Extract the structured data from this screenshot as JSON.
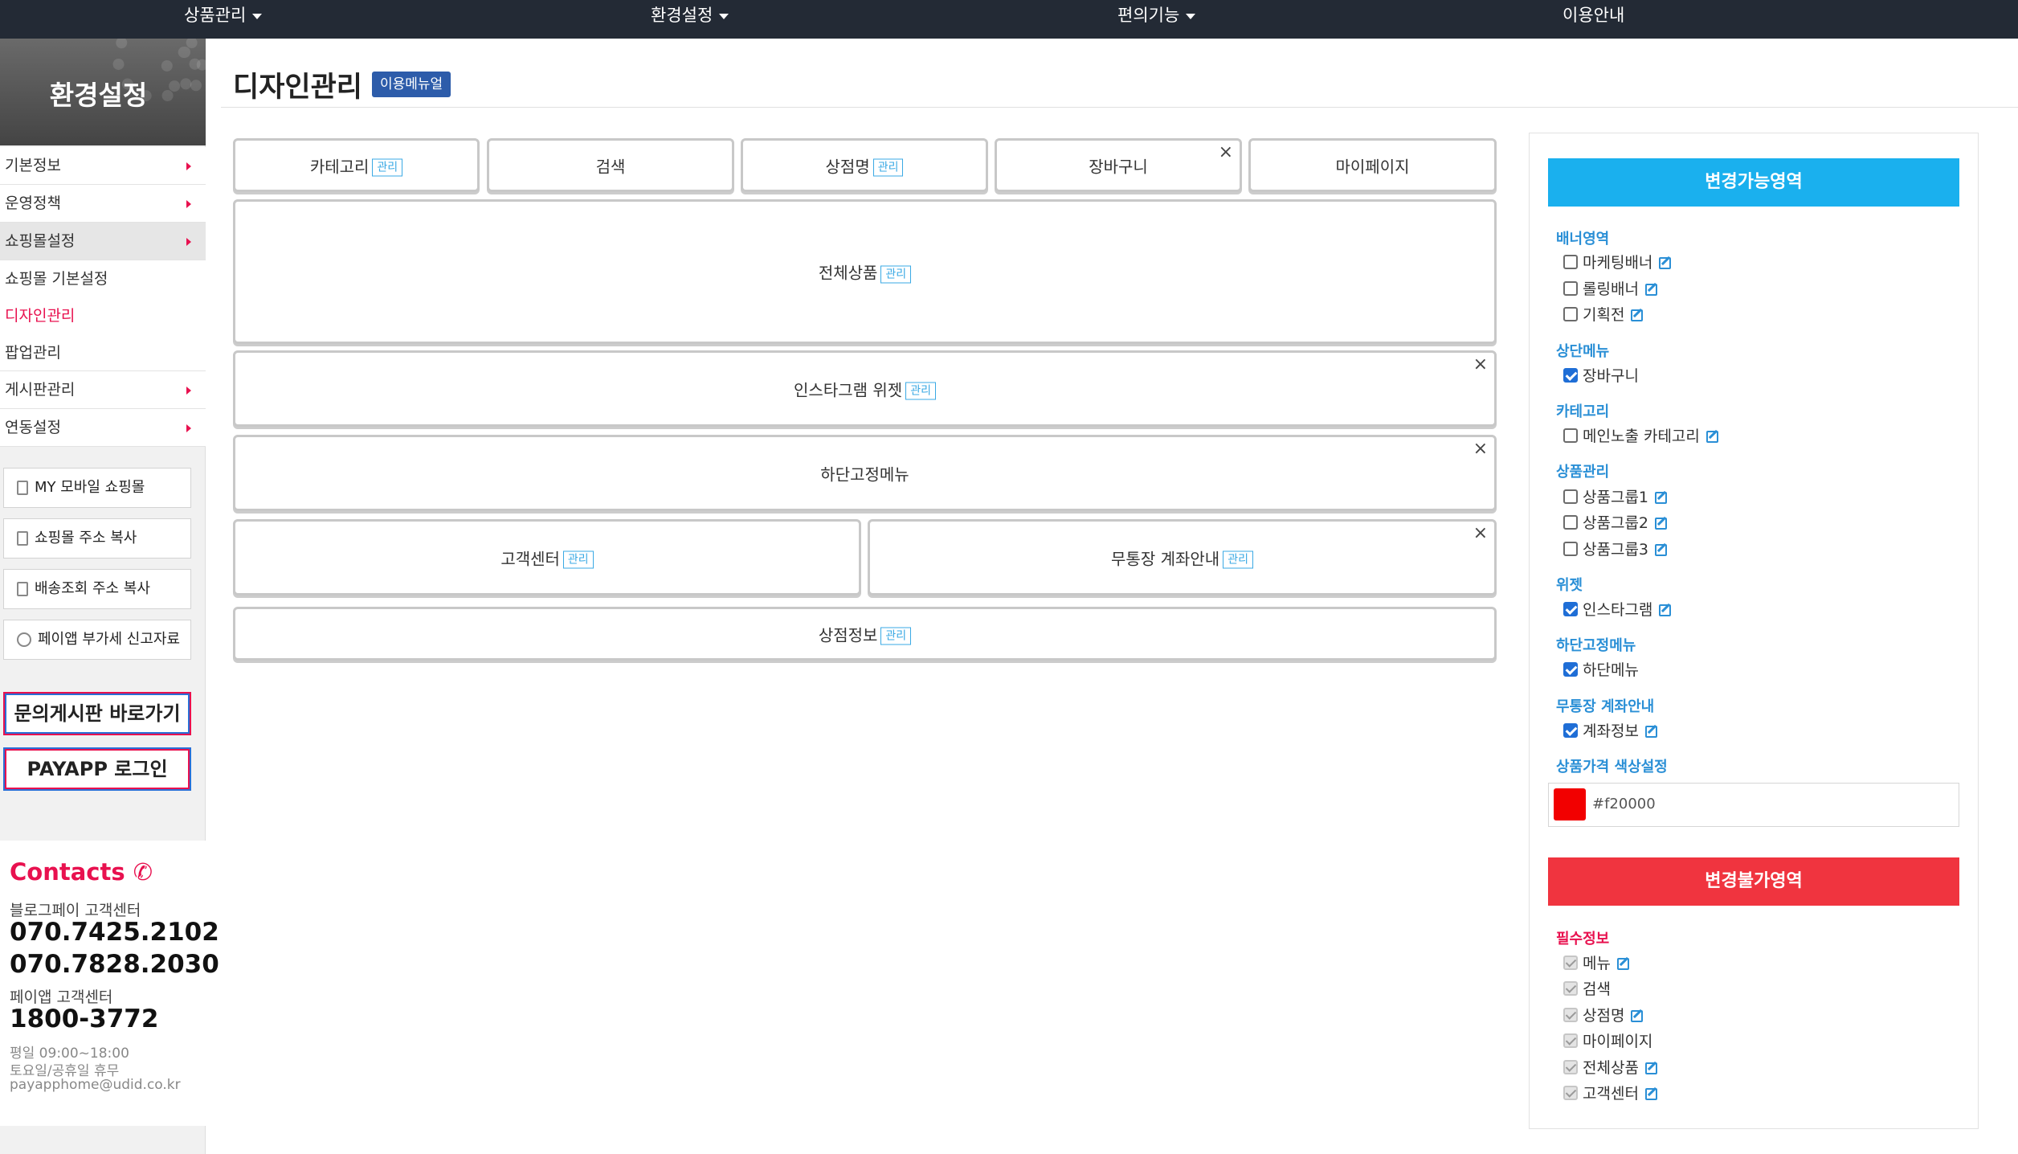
{
  "topnav": {
    "items": [
      {
        "label": "상품관리",
        "caret": true
      },
      {
        "label": "환경설정",
        "caret": true
      },
      {
        "label": "편의기능",
        "caret": true
      },
      {
        "label": "이용안내",
        "caret": false
      }
    ]
  },
  "sidebar": {
    "title": "환경설정",
    "menu": [
      {
        "label": "기본정보"
      },
      {
        "label": "운영정책"
      },
      {
        "label": "쇼핑몰설정"
      },
      {
        "label": "쇼핑몰 기본설정"
      },
      {
        "label": "디자인관리"
      },
      {
        "label": "팝업관리"
      },
      {
        "label": "게시판관리"
      },
      {
        "label": "연동설정"
      }
    ],
    "tools": [
      {
        "label": "MY 모바일 쇼핑몰"
      },
      {
        "label": "쇼핑몰 주소 복사"
      },
      {
        "label": "배송조회 주소 복사"
      },
      {
        "label": "페이앱 부가세 신고자료"
      }
    ],
    "board_btn": "문의게시판 바로가기",
    "login_btn": "PAYAPP 로그인",
    "contacts": {
      "heading": "Contacts",
      "center1_label": "블로그페이 고객센터",
      "center1_phone1": "070.7425.2102",
      "center1_phone2": "070.7828.2030",
      "center2_label": "페이앱 고객센터",
      "center2_phone": "1800-3772",
      "hours": "평일 09:00~18:00",
      "holiday": "토요일/공휴일 휴무",
      "email": "payapphome@udid.co.kr"
    }
  },
  "main": {
    "title": "디자인관리",
    "manual_btn": "이용메뉴얼",
    "manage_label": "관리",
    "close_glyph": "×",
    "row1": [
      {
        "label": "카테고리"
      },
      {
        "label": "검색"
      },
      {
        "label": "상점명"
      },
      {
        "label": "장바구니"
      },
      {
        "label": "마이페이지"
      }
    ],
    "all_products": "전체상품",
    "instagram": "인스타그램 위젯",
    "bottom_menu": "하단고정메뉴",
    "customer_center": "고객센터",
    "account_info": "무통장 계좌안내",
    "store_info": "상점정보"
  },
  "panel": {
    "changeable_title": "변경가능영역",
    "unchangeable_title": "변경불가영역",
    "sections": {
      "banner": {
        "title": "배너영역",
        "options": [
          "마케팅배너",
          "롤링배너",
          "기획전"
        ]
      },
      "topmenu": {
        "title": "상단메뉴",
        "options": [
          "장바구니"
        ]
      },
      "category": {
        "title": "카테고리",
        "options": [
          "메인노출 카테고리"
        ]
      },
      "product": {
        "title": "상품관리",
        "options": [
          "상품그룹1",
          "상품그룹2",
          "상품그룹3"
        ]
      },
      "widget": {
        "title": "위젯",
        "options": [
          "인스타그램"
        ]
      },
      "bottom": {
        "title": "하단고정메뉴",
        "options": [
          "하단메뉴"
        ]
      },
      "account": {
        "title": "무통장 계좌안내",
        "options": [
          "계좌정보"
        ]
      },
      "price_color": {
        "title": "상품가격 색상설정",
        "value": "#f20000"
      },
      "required": {
        "title": "필수정보",
        "options": [
          "메뉴",
          "검색",
          "상점명",
          "마이페이지",
          "전체상품",
          "고객센터"
        ]
      }
    },
    "colors": {
      "blue": "#1ab0ee",
      "red": "#f0343f",
      "swatch": "#f20000"
    }
  }
}
